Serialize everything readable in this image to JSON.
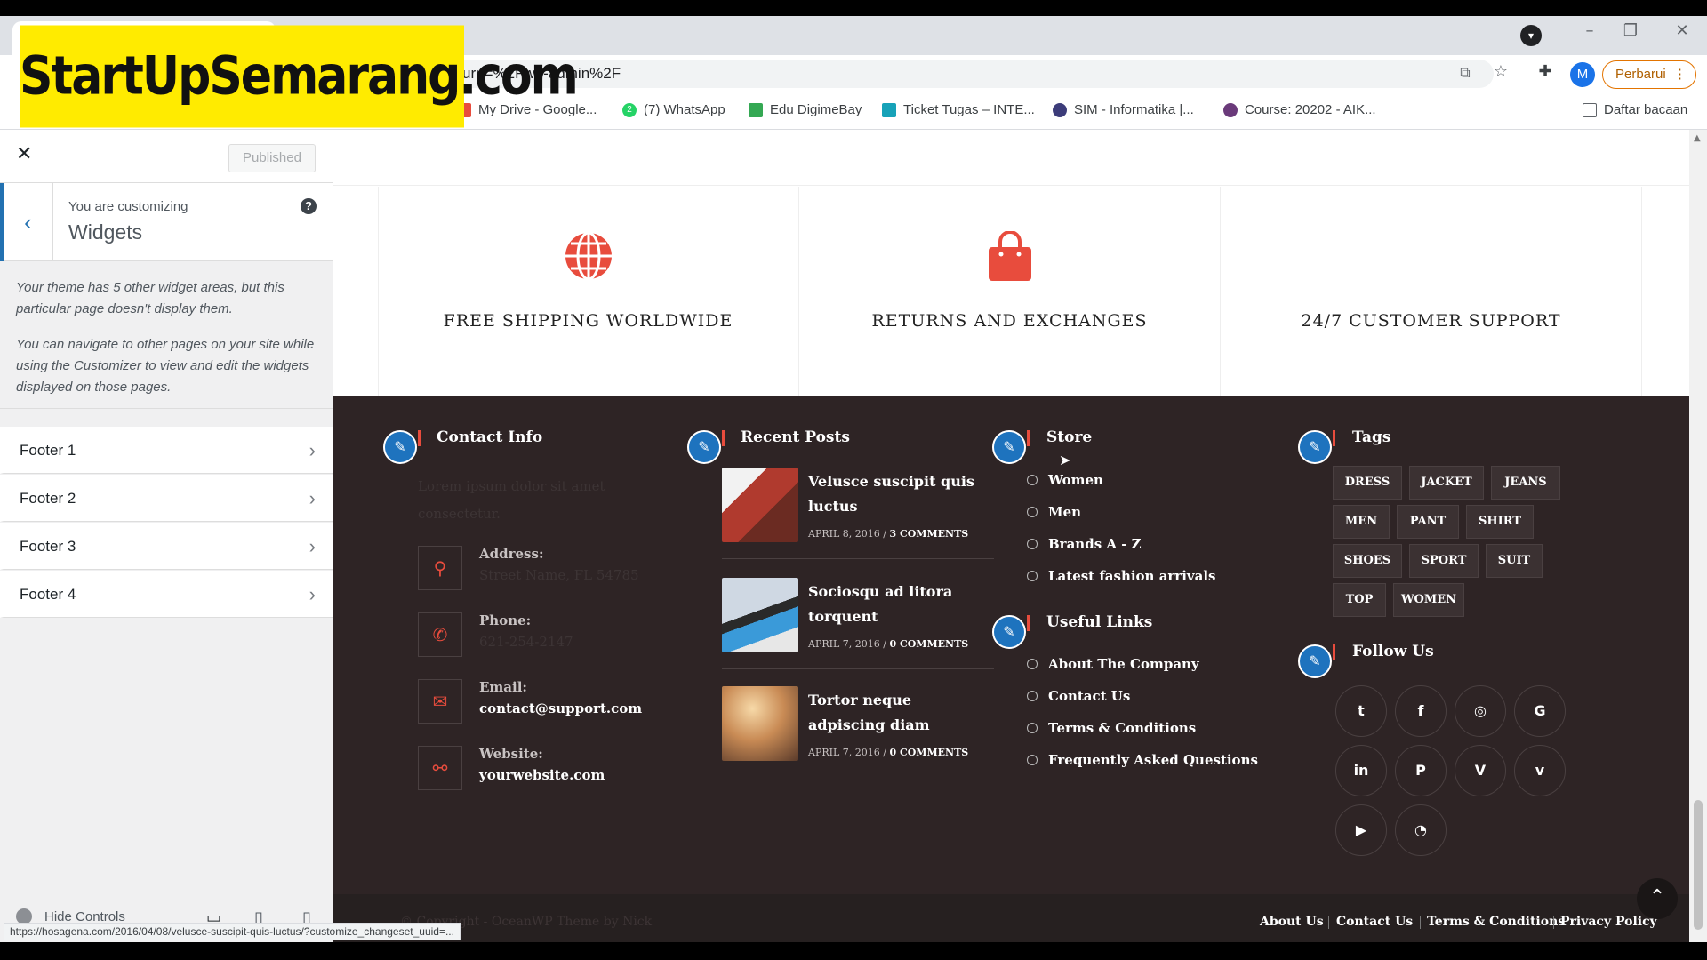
{
  "browser": {
    "address": "urn=%2Fwp-admin%2F",
    "update_button": "Perbarui",
    "profile_initial": "M",
    "bookmarks": [
      {
        "label": "My Drive - Google..."
      },
      {
        "label": "(7) WhatsApp",
        "badge": "2"
      },
      {
        "label": "Edu DigimeBay"
      },
      {
        "label": "Ticket Tugas – INTE..."
      },
      {
        "label": "SIM - Informatika |..."
      },
      {
        "label": "Course: 20202 - AIK..."
      }
    ],
    "reading_list": "Daftar bacaan"
  },
  "watermark": "StartUpSemarang.com",
  "customizer": {
    "published": "Published",
    "customizing_label": "You are customizing",
    "section_title": "Widgets",
    "desc1": "Your theme has 5 other widget areas, but this particular page doesn't display them.",
    "desc2": "You can navigate to other pages on your site while using the Customizer to view and edit the widgets displayed on those pages.",
    "footer_items": [
      "Footer 1",
      "Footer 2",
      "Footer 3",
      "Footer 4"
    ],
    "hide_controls": "Hide Controls",
    "status_url": "https://hosagena.com/2016/04/08/velusce-suscipit-quis-luctus/?customize_changeset_uuid=..."
  },
  "features": [
    "FREE SHIPPING WORLDWIDE",
    "RETURNS AND EXCHANGES",
    "24/7 CUSTOMER SUPPORT"
  ],
  "footer": {
    "contact": {
      "title": "Contact Info",
      "intro": "Lorem ipsum dolor sit amet consectetur.",
      "address_label": "Address:",
      "address_value": "Street Name, FL 54785",
      "phone_label": "Phone:",
      "phone_value": "621-254-2147",
      "email_label": "Email:",
      "email_value": "contact@support.com",
      "website_label": "Website:",
      "website_value": "yourwebsite.com"
    },
    "recent": {
      "title": "Recent Posts",
      "posts": [
        {
          "title": "Velusce suscipit quis luctus",
          "date": "APRIL 8, 2016",
          "comments": "3 COMMENTS"
        },
        {
          "title": "Sociosqu ad litora torquent",
          "date": "APRIL 7, 2016",
          "comments": "0 COMMENTS"
        },
        {
          "title": "Tortor neque adpiscing diam",
          "date": "APRIL 7, 2016",
          "comments": "0 COMMENTS"
        }
      ]
    },
    "store": {
      "title": "Store",
      "items": [
        "Women",
        "Men",
        "Brands A - Z",
        "Latest fashion arrivals"
      ]
    },
    "useful": {
      "title": "Useful Links",
      "items": [
        "About The Company",
        "Contact Us",
        "Terms & Conditions",
        "Frequently Asked Questions"
      ]
    },
    "tags": {
      "title": "Tags",
      "items": [
        "DRESS",
        "JACKET",
        "JEANS",
        "MEN",
        "PANT",
        "SHIRT",
        "SHOES",
        "SPORT",
        "SUIT",
        "TOP",
        "WOMEN"
      ]
    },
    "follow": {
      "title": "Follow Us"
    },
    "copyright": "© Copyright - OceanWP Theme by Nick",
    "links": [
      "About Us",
      "Contact Us",
      "Terms & Conditions",
      "Privacy Policy"
    ]
  },
  "colors": {
    "accent": "#e84c3d",
    "footer_bg": "#2e2425",
    "wp_blue": "#2271b1"
  }
}
